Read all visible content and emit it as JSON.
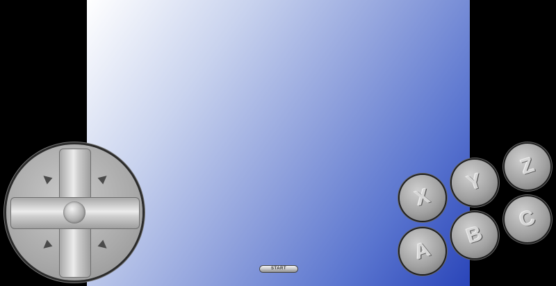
{
  "screen": {
    "background": "blue-white-gradient"
  },
  "dpad": {
    "icon": "dpad-icon"
  },
  "buttons": {
    "x": {
      "label": "X"
    },
    "y": {
      "label": "Y"
    },
    "z": {
      "label": "Z"
    },
    "a": {
      "label": "A"
    },
    "b": {
      "label": "B"
    },
    "c": {
      "label": "C"
    },
    "start": {
      "label": "START"
    }
  },
  "colors": {
    "bezel": "#000000",
    "screen_light": "#ffffff",
    "screen_dark": "#2a45b9",
    "button_gray": "#a2a2a2"
  }
}
